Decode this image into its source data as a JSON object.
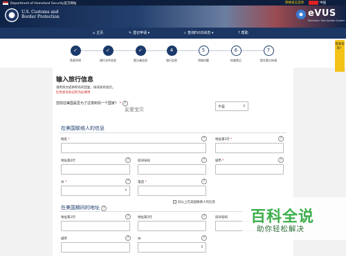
{
  "topbar": {
    "dhs_label": "Department of Homeland Security官方网站",
    "language_toggle": "转换语言选项",
    "current_language": "中国"
  },
  "header": {
    "agency_line1": "U.S. Customs and",
    "agency_line2": "Border Protection",
    "logo_text": "eVUS",
    "logo_sub": "Electronic Visa Update System"
  },
  "nav": {
    "items": [
      {
        "icon": "home-icon",
        "glyph": "⌂",
        "label": "主页"
      },
      {
        "icon": "edit-icon",
        "glyph": "✎",
        "label": "登记申请 ▾"
      },
      {
        "icon": "search-icon",
        "glyph": "⌕",
        "label": "查询EVUS状态 ▾"
      },
      {
        "icon": "help-icon",
        "glyph": "?",
        "label": "帮助"
      }
    ]
  },
  "steps": [
    {
      "num": "1",
      "label": "免责声明",
      "state": "done"
    },
    {
      "num": "2",
      "label": "旅行文件信息",
      "state": "done"
    },
    {
      "num": "3",
      "label": "登记者信息",
      "state": "done"
    },
    {
      "num": "4",
      "label": "旅行信息",
      "state": "current"
    },
    {
      "num": "5",
      "label": "资格问题",
      "state": "todo"
    },
    {
      "num": "6",
      "label": "检查登记",
      "state": "todo"
    },
    {
      "num": "7",
      "label": "提交登记申请",
      "state": "todo"
    }
  ],
  "sidetab": {
    "label": "需要帮助？"
  },
  "form": {
    "title": "输入旅行信息",
    "intro": "请用英文提供所有的回复，除非另有指示。",
    "required_note": "红色星号标记的为必填项",
    "question": "您前往美国是否为了过境到另一个国家？",
    "question_star": "*",
    "question_overlay": "友爱宝贝",
    "question_select": "不是",
    "contact_section": "在美国联络人的信息",
    "contact_fields": {
      "name": "姓名",
      "address1": "地址第1行",
      "address2": "地址第2行",
      "apt": "房间号码",
      "city": "城市",
      "state": "州",
      "phone": "电话"
    },
    "same_address": "同以上在美国联络人的信息",
    "stay_section": "在美国期间的地址",
    "stay_fields": {
      "address1": "地址第1行",
      "address2": "地址第2行",
      "apt": "房间号码",
      "city": "城市",
      "state": "州"
    }
  },
  "watermark": {
    "main": "百科全说",
    "sub": "助你轻松解决"
  }
}
